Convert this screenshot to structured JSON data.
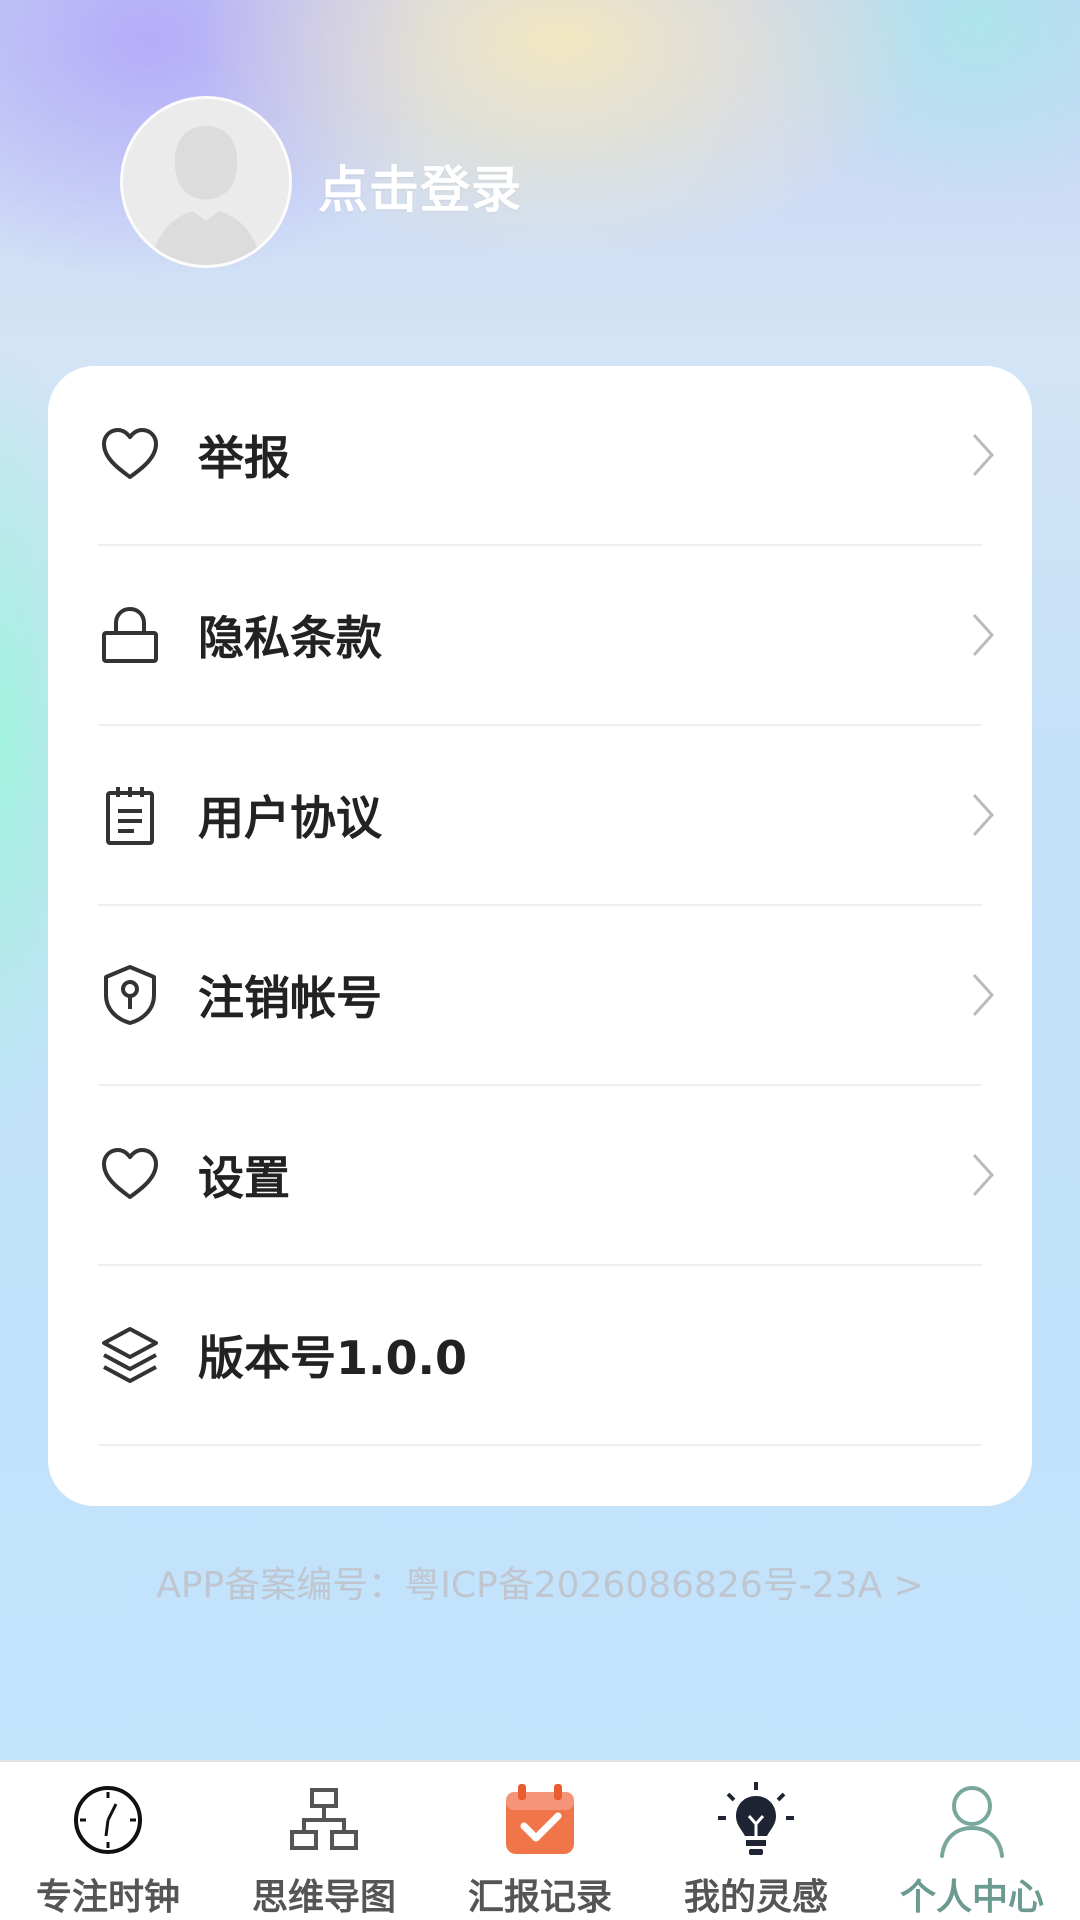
{
  "header": {
    "login_label": "点击登录"
  },
  "menu": {
    "items": [
      {
        "label": "举报",
        "icon": "heart-icon",
        "has_chevron": true
      },
      {
        "label": "隐私条款",
        "icon": "lock-icon",
        "has_chevron": true
      },
      {
        "label": "用户协议",
        "icon": "notepad-icon",
        "has_chevron": true
      },
      {
        "label": "注销帐号",
        "icon": "shield-key-icon",
        "has_chevron": true
      },
      {
        "label": "设置",
        "icon": "heart-icon",
        "has_chevron": true
      },
      {
        "label": "版本号1.0.0",
        "icon": "layers-icon",
        "has_chevron": false
      }
    ]
  },
  "footer": {
    "icp_text": "APP备案编号：粤ICP备2026086826号-23A >"
  },
  "tabbar": {
    "tabs": [
      {
        "label": "专注时钟",
        "icon": "clock-icon",
        "active": false
      },
      {
        "label": "思维导图",
        "icon": "org-chart-icon",
        "active": false
      },
      {
        "label": "汇报记录",
        "icon": "calendar-check-icon",
        "active": false
      },
      {
        "label": "我的灵感",
        "icon": "lightbulb-icon",
        "active": false
      },
      {
        "label": "个人中心",
        "icon": "user-icon",
        "active": true
      }
    ]
  },
  "colors": {
    "active_tab": "#6a9a90",
    "calendar_orange": "#f0764a",
    "menu_text": "#222222",
    "chevron": "#bbbbbb"
  }
}
